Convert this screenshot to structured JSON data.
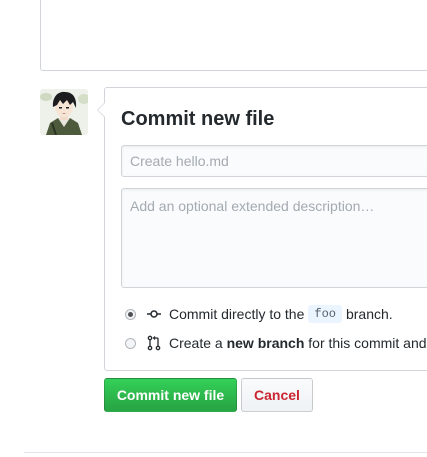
{
  "commit_form": {
    "title": "Commit new file",
    "summary": {
      "value": "",
      "placeholder": "Create hello.md"
    },
    "description": {
      "value": "",
      "placeholder": "Add an optional extended description…"
    },
    "options": [
      {
        "selected": true,
        "icon": "git-commit-icon",
        "text_before": "Commit directly to the",
        "branch": "foo",
        "text_after": "branch."
      },
      {
        "selected": false,
        "icon": "git-pull-request-icon",
        "text_before": "Create a",
        "bold": "new branch",
        "text_after": "for this commit and"
      }
    ]
  },
  "actions": {
    "commit_label": "Commit new file",
    "cancel_label": "Cancel"
  },
  "colors": {
    "primary_button": "#28a745",
    "cancel_text": "#cb2431",
    "border": "#d1d5da",
    "branch_highlight": "#eaf5ff"
  }
}
